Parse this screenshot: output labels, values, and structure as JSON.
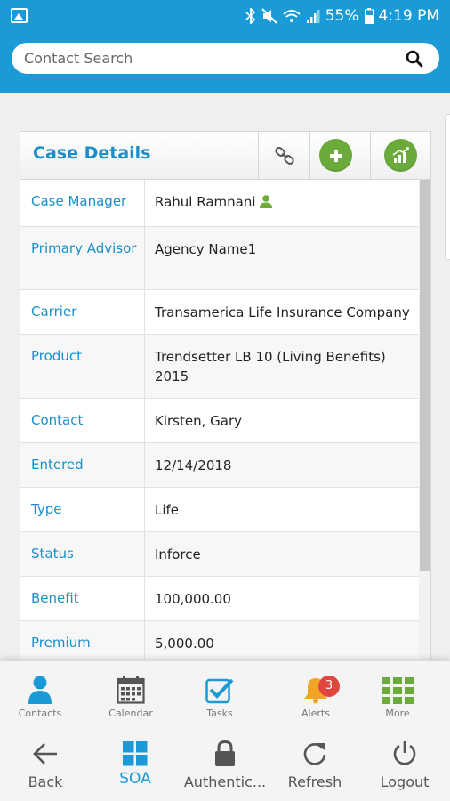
{
  "status_bar": {
    "battery": "55%",
    "time": "4:19 PM",
    "icons": [
      "picture-icon",
      "bluetooth-icon",
      "mute-icon",
      "wifi-icon",
      "signal-icon",
      "battery-icon"
    ]
  },
  "search": {
    "placeholder": "Contact Search",
    "value": ""
  },
  "card": {
    "title": "Case Details",
    "buttons": [
      "link-icon",
      "add-icon",
      "chart-icon"
    ],
    "rows": [
      {
        "label": "Case Manager",
        "value": "Rahul Ramnani"
      },
      {
        "label": "Primary Advisor",
        "value": "Agency Name1"
      },
      {
        "label": "Carrier",
        "value": "Transamerica Life Insurance Company"
      },
      {
        "label": "Product",
        "value": "Trendsetter LB 10 (Living Benefits) 2015"
      },
      {
        "label": "Contact",
        "value": "Kirsten, Gary"
      },
      {
        "label": "Entered",
        "value": "12/14/2018"
      },
      {
        "label": "Type",
        "value": "Life"
      },
      {
        "label": "Status",
        "value": "Inforce"
      },
      {
        "label": "Benefit",
        "value": "100,000.00"
      },
      {
        "label": "Premium",
        "value": "5,000.00"
      }
    ]
  },
  "nav_top": [
    {
      "label": "Contacts",
      "icon": "person-icon"
    },
    {
      "label": "Calendar",
      "icon": "calendar-icon"
    },
    {
      "label": "Tasks",
      "icon": "tasks-icon"
    },
    {
      "label": "Alerts",
      "icon": "bell-icon",
      "badge": "3"
    },
    {
      "label": "More",
      "icon": "grid-icon"
    }
  ],
  "nav_bottom": [
    {
      "label": "Back",
      "icon": "back-arrow-icon"
    },
    {
      "label": "SOA",
      "icon": "windows-icon",
      "active": true
    },
    {
      "label": "Authentic...",
      "icon": "lock-icon"
    },
    {
      "label": "Refresh",
      "icon": "refresh-icon"
    },
    {
      "label": "Logout",
      "icon": "power-icon"
    }
  ],
  "colors": {
    "primary": "#1a9ad6",
    "label": "#1a8fc9",
    "green": "#6aab3c",
    "badge": "#e0463d"
  }
}
